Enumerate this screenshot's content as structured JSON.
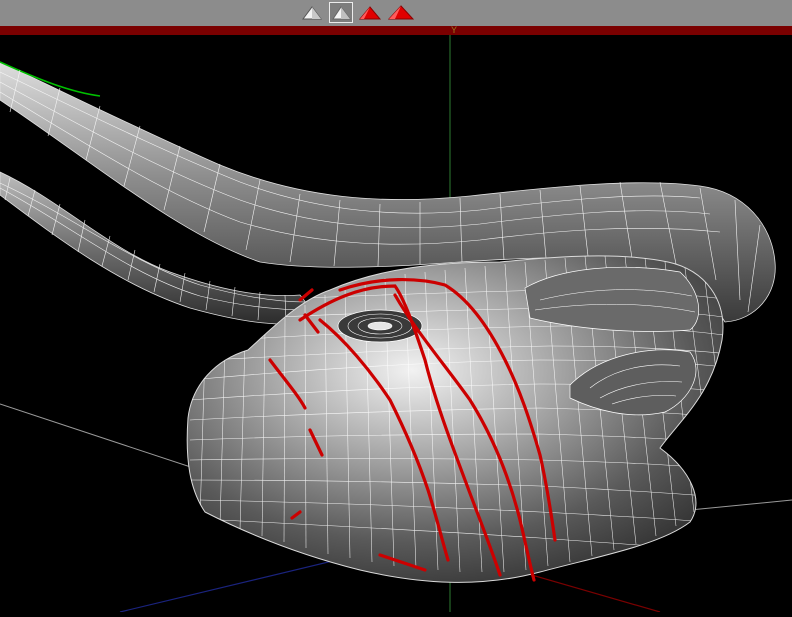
{
  "toolbar": {
    "buttons": [
      {
        "name": "shading-mode-wire",
        "icon": "white-triangle-icon",
        "active": false
      },
      {
        "name": "shading-mode-flat",
        "icon": "white-triangle-framed-icon",
        "active": true
      },
      {
        "name": "shading-mode-smooth",
        "icon": "red-triangle-icon",
        "active": false
      },
      {
        "name": "shading-mode-textured",
        "icon": "red-triangle-large-icon",
        "active": false
      }
    ]
  },
  "viewport": {
    "axis_label": "Y",
    "background": "#000000",
    "colors": {
      "mesh_surface": "#9a9a9a",
      "wireframe": "#ffffff",
      "selected_edge_loops": "#cc0000",
      "y_axis": "#2e7d32",
      "x_axis": "#8a0000",
      "z_axis": "#1a237e",
      "highlighted_edge": "#00c000"
    },
    "model": "bull-head-mesh"
  }
}
